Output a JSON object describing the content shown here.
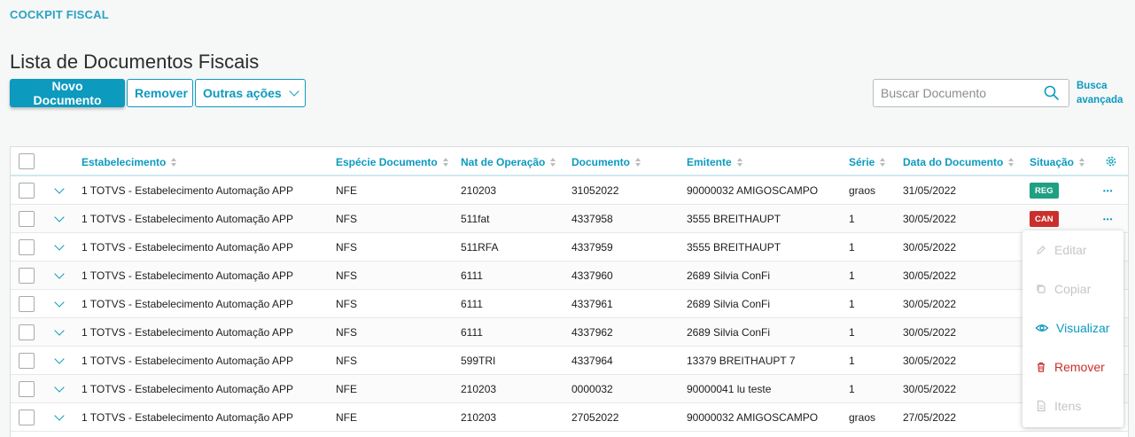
{
  "breadcrumb": "COCKPIT FISCAL",
  "title": "Lista de Documentos Fiscais",
  "actions": {
    "primary": "Novo Documento",
    "remove": "Remover",
    "more": "Outras ações"
  },
  "search": {
    "placeholder": "Buscar Documento",
    "advanced_line1": "Busca",
    "advanced_line2": "avançada"
  },
  "columns": [
    "Estabelecimento",
    "Espécie Documento",
    "Nat de Operação",
    "Documento",
    "Emitente",
    "Série",
    "Data do Documento",
    "Situação"
  ],
  "rows": [
    {
      "estab": "1 TOTVS - Estabelecimento Automação APP",
      "especie": "NFE",
      "nat": "210203",
      "doc": "31052022",
      "emitente": "90000032 AMIGOSCAMPO",
      "serie": "graos",
      "data": "31/05/2022",
      "situacao": "REG"
    },
    {
      "estab": "1 TOTVS - Estabelecimento Automação APP",
      "especie": "NFS",
      "nat": "511fat",
      "doc": "4337958",
      "emitente": "3555 BREITHAUPT",
      "serie": "1",
      "data": "30/05/2022",
      "situacao": "CAN"
    },
    {
      "estab": "1 TOTVS - Estabelecimento Automação APP",
      "especie": "NFS",
      "nat": "511RFA",
      "doc": "4337959",
      "emitente": "3555 BREITHAUPT",
      "serie": "1",
      "data": "30/05/2022",
      "situacao": ""
    },
    {
      "estab": "1 TOTVS - Estabelecimento Automação APP",
      "especie": "NFS",
      "nat": "6111",
      "doc": "4337960",
      "emitente": "2689 Silvia ConFi",
      "serie": "1",
      "data": "30/05/2022",
      "situacao": ""
    },
    {
      "estab": "1 TOTVS - Estabelecimento Automação APP",
      "especie": "NFS",
      "nat": "6111",
      "doc": "4337961",
      "emitente": "2689 Silvia ConFi",
      "serie": "1",
      "data": "30/05/2022",
      "situacao": ""
    },
    {
      "estab": "1 TOTVS - Estabelecimento Automação APP",
      "especie": "NFS",
      "nat": "6111",
      "doc": "4337962",
      "emitente": "2689 Silvia ConFi",
      "serie": "1",
      "data": "30/05/2022",
      "situacao": ""
    },
    {
      "estab": "1 TOTVS - Estabelecimento Automação APP",
      "especie": "NFS",
      "nat": "599TRI",
      "doc": "4337964",
      "emitente": "13379 BREITHAUPT 7",
      "serie": "1",
      "data": "30/05/2022",
      "situacao": ""
    },
    {
      "estab": "1 TOTVS - Estabelecimento Automação APP",
      "especie": "NFE",
      "nat": "210203",
      "doc": "0000032",
      "emitente": "90000041 lu teste",
      "serie": "1",
      "data": "30/05/2022",
      "situacao": ""
    },
    {
      "estab": "1 TOTVS - Estabelecimento Automação APP",
      "especie": "NFE",
      "nat": "210203",
      "doc": "27052022",
      "emitente": "90000032 AMIGOSCAMPO",
      "serie": "graos",
      "data": "27/05/2022",
      "situacao": ""
    }
  ],
  "status_colors": {
    "REG": "#1fa083",
    "CAN": "#c9302c"
  },
  "row_menu": [
    {
      "label": "Editar",
      "icon": "pencil-icon",
      "state": "disabled"
    },
    {
      "label": "Copiar",
      "icon": "copy-icon",
      "state": "disabled"
    },
    {
      "label": "Visualizar",
      "icon": "eye-icon",
      "state": "active"
    },
    {
      "label": "Remover",
      "icon": "trash-icon",
      "state": "danger"
    },
    {
      "label": "Itens",
      "icon": "document-icon",
      "state": "disabled"
    }
  ],
  "colors": {
    "accent": "#0c9abe",
    "danger": "#c9302c",
    "success": "#1fa083"
  }
}
